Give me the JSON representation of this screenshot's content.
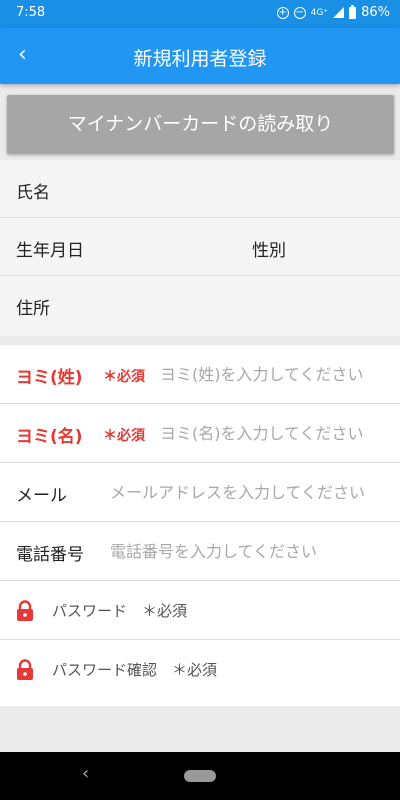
{
  "status_bar": {
    "time": "7:58",
    "network": "4G⁺",
    "battery": "86%"
  },
  "app_bar": {
    "back": "‹",
    "title": "新規利用者登録"
  },
  "card_button": {
    "label": "マイナンバーカードの読み取り"
  },
  "card_info": {
    "name_label": "氏名",
    "birthdate_label": "生年月日",
    "gender_label": "性別",
    "address_label": "住所"
  },
  "form": {
    "yomi_sei": {
      "label": "ヨミ(姓)",
      "required": "＊必須",
      "placeholder": "ヨミ(姓)を入力してください",
      "value": ""
    },
    "yomi_mei": {
      "label": "ヨミ(名)",
      "required": "＊必須",
      "placeholder": "ヨミ(名)を入力してください",
      "value": ""
    },
    "email": {
      "label": "メール",
      "placeholder": "メールアドレスを入力してください",
      "value": ""
    },
    "phone": {
      "label": "電話番号",
      "placeholder": "電話番号を入力してください",
      "value": ""
    },
    "password": {
      "label": "パスワード　＊必須"
    },
    "password_confirm": {
      "label": "パスワード確認　＊必須"
    }
  },
  "colors": {
    "status_bar": "#1a8fe6",
    "app_bar": "#2196f3",
    "required_red": "#e53935",
    "card_button": "#a6a6a6"
  },
  "icons": {
    "lock": "lock-icon",
    "back": "chevron-left-icon",
    "nav_back": "nav-back-icon",
    "nav_home": "nav-home-pill"
  }
}
